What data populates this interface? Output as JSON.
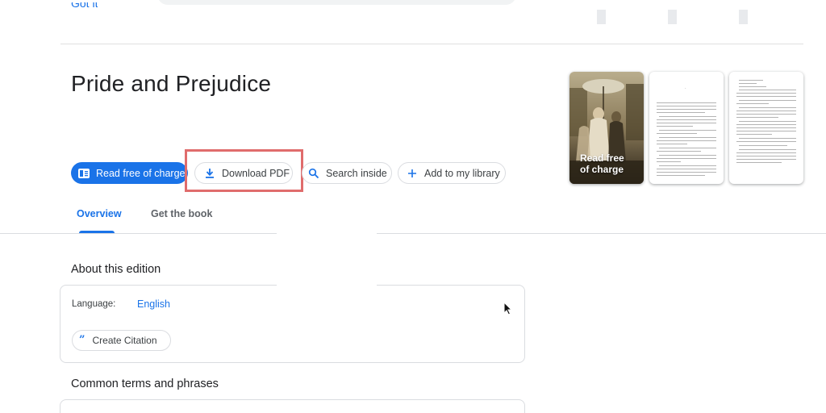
{
  "top_link": {
    "label": "Got it"
  },
  "book": {
    "title": "Pride and Prejudice"
  },
  "actions": {
    "read_free": "Read free of charge",
    "download_pdf": "Download PDF",
    "search_inside": "Search inside",
    "add_library": "Add to my library"
  },
  "tabs": [
    {
      "label": "Overview",
      "active": true
    },
    {
      "label": "Get the book",
      "active": false
    }
  ],
  "previews": {
    "cover_caption_line1": "Read free",
    "cover_caption_line2": "of charge"
  },
  "about": {
    "heading": "About this edition",
    "language_label": "Language:",
    "language_value": "English",
    "citation_label": "Create Citation"
  },
  "terms": {
    "heading": "Common terms and phrases"
  },
  "colors": {
    "accent": "#1a73e8",
    "highlight": "#e06c6c",
    "border": "#dadce0"
  }
}
